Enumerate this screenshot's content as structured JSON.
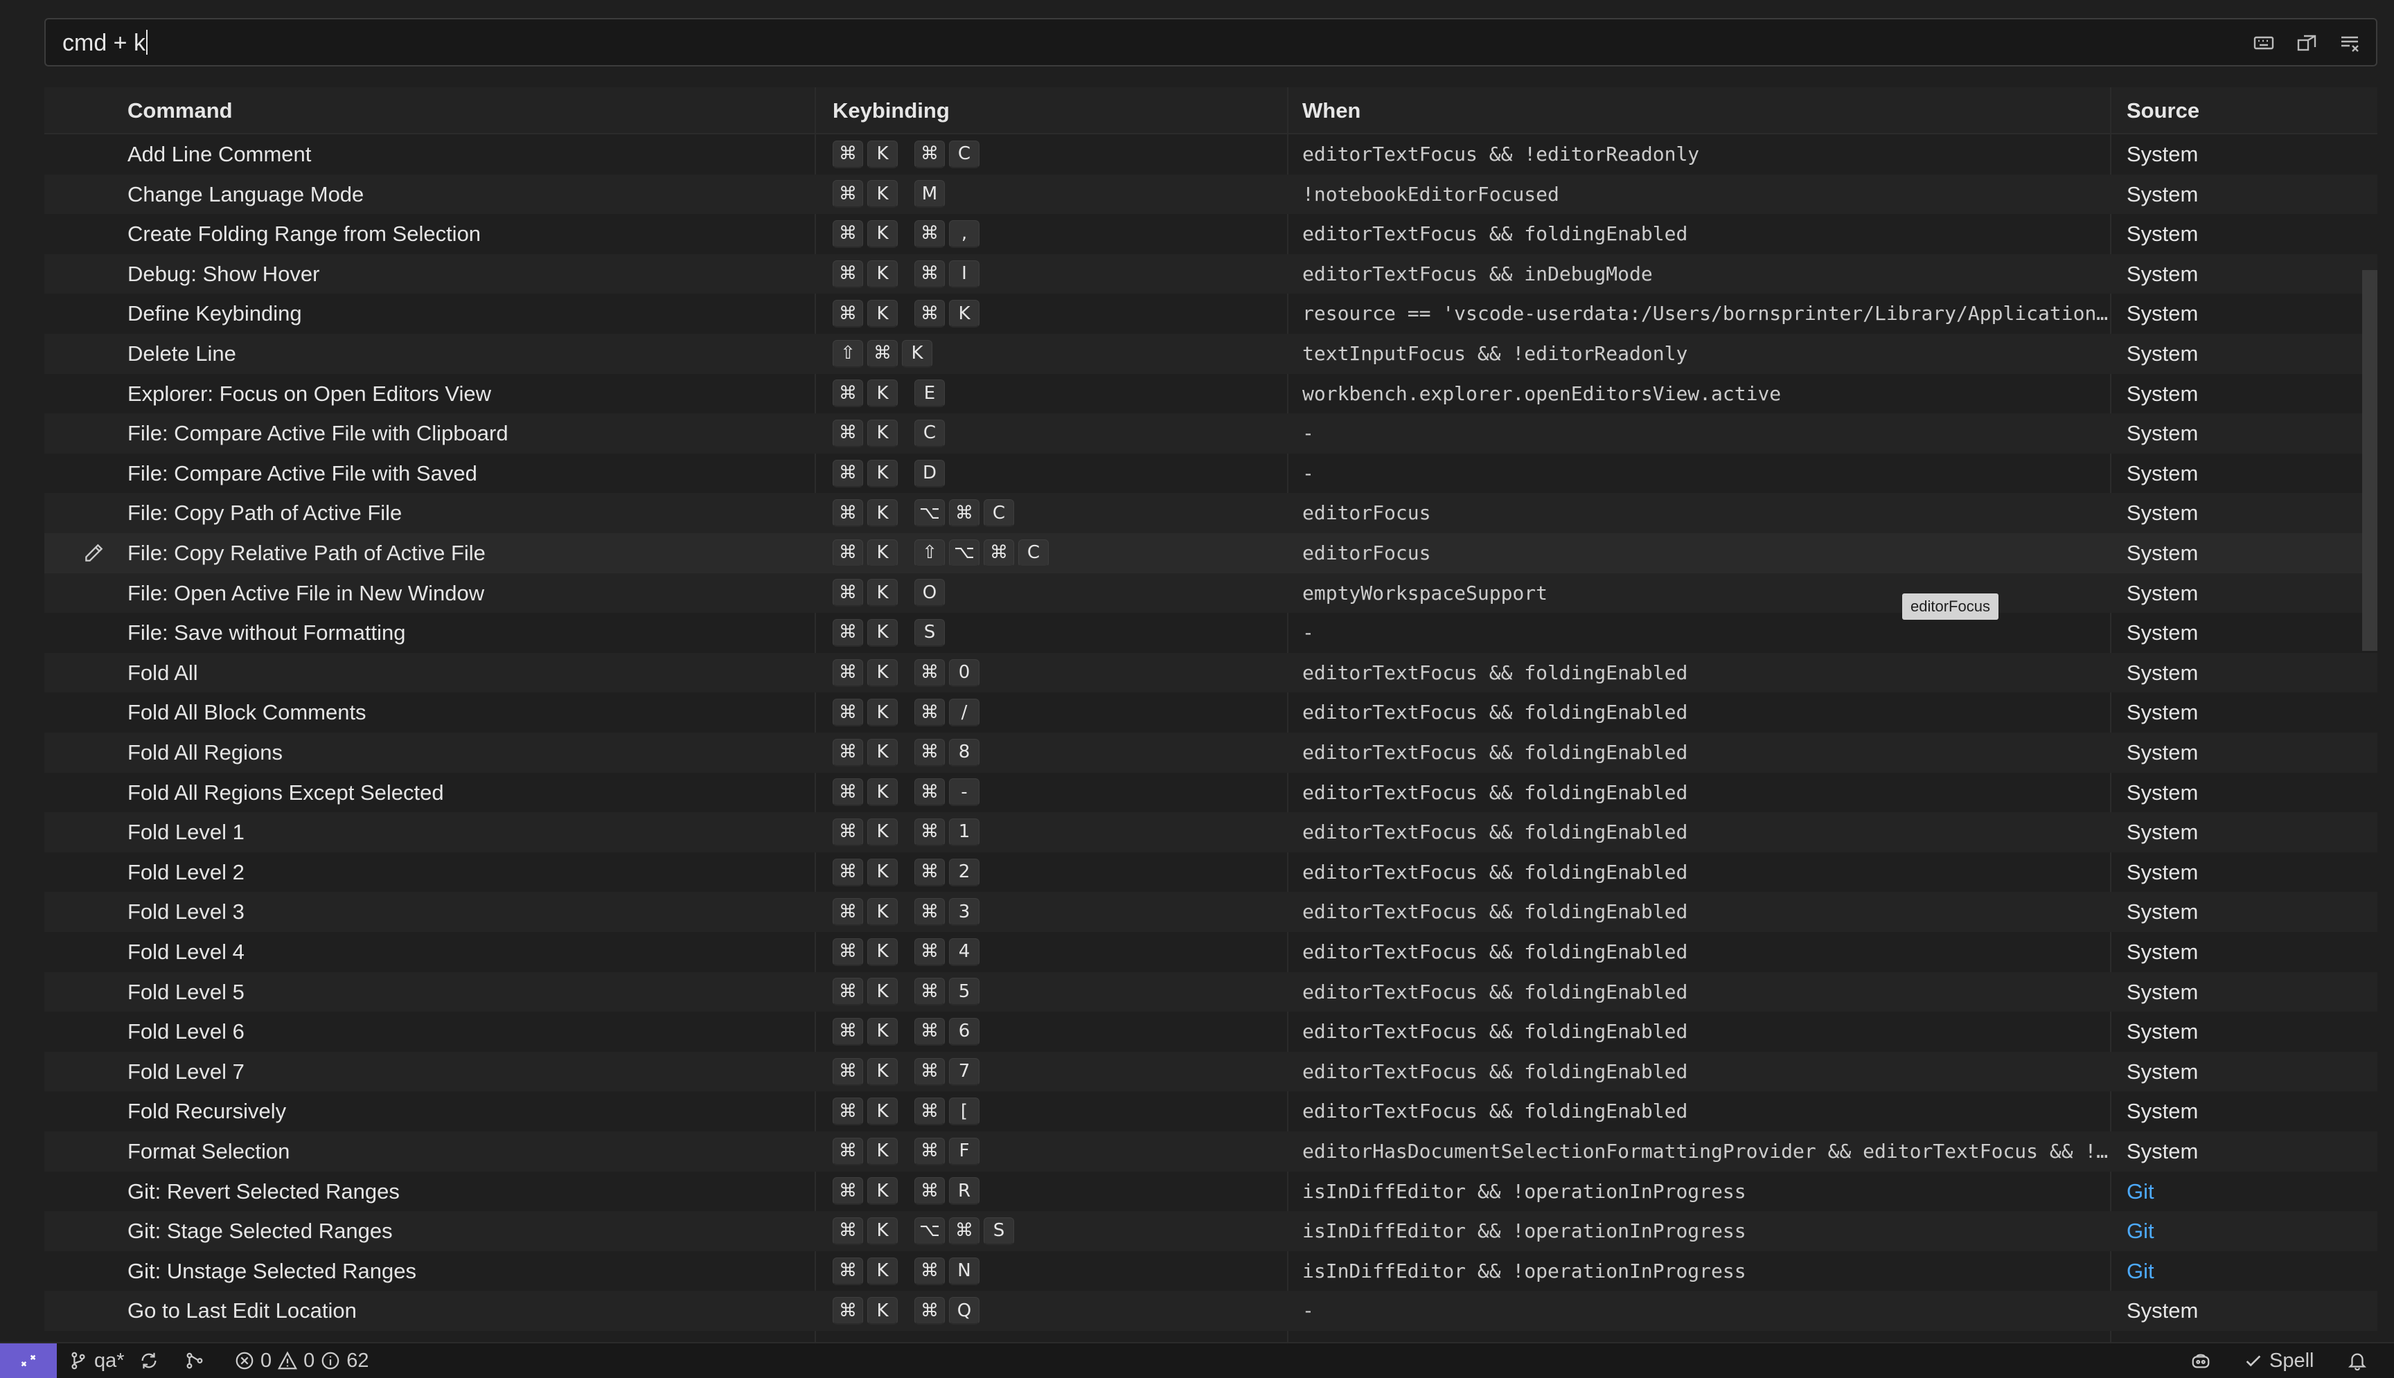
{
  "search": {
    "value": "cmd + k"
  },
  "table": {
    "headers": {
      "command": "Command",
      "keybinding": "Keybinding",
      "when": "When",
      "source": "Source"
    },
    "rows": [
      {
        "command": "Add Line Comment",
        "keys": [
          [
            "⌘",
            "K"
          ],
          [
            "⌘",
            "C"
          ]
        ],
        "when": "editorTextFocus && !editorReadonly",
        "source": "System"
      },
      {
        "command": "Change Language Mode",
        "keys": [
          [
            "⌘",
            "K"
          ],
          [
            "M"
          ]
        ],
        "when": "!notebookEditorFocused",
        "source": "System"
      },
      {
        "command": "Create Folding Range from Selection",
        "keys": [
          [
            "⌘",
            "K"
          ],
          [
            "⌘",
            ","
          ]
        ],
        "when": "editorTextFocus && foldingEnabled",
        "source": "System"
      },
      {
        "command": "Debug: Show Hover",
        "keys": [
          [
            "⌘",
            "K"
          ],
          [
            "⌘",
            "I"
          ]
        ],
        "when": "editorTextFocus && inDebugMode",
        "source": "System"
      },
      {
        "command": "Define Keybinding",
        "keys": [
          [
            "⌘",
            "K"
          ],
          [
            "⌘",
            "K"
          ]
        ],
        "when": "resource == 'vscode-userdata:/Users/bornsprinter/Library/Application…",
        "source": "System"
      },
      {
        "command": "Delete Line",
        "keys": [
          [
            "⇧",
            "⌘",
            "K"
          ]
        ],
        "when": "textInputFocus && !editorReadonly",
        "source": "System"
      },
      {
        "command": "Explorer: Focus on Open Editors View",
        "keys": [
          [
            "⌘",
            "K"
          ],
          [
            "E"
          ]
        ],
        "when": "workbench.explorer.openEditorsView.active",
        "source": "System"
      },
      {
        "command": "File: Compare Active File with Clipboard",
        "keys": [
          [
            "⌘",
            "K"
          ],
          [
            "C"
          ]
        ],
        "when": "-",
        "source": "System"
      },
      {
        "command": "File: Compare Active File with Saved",
        "keys": [
          [
            "⌘",
            "K"
          ],
          [
            "D"
          ]
        ],
        "when": "-",
        "source": "System"
      },
      {
        "command": "File: Copy Path of Active File",
        "keys": [
          [
            "⌘",
            "K"
          ],
          [
            "⌥",
            "⌘",
            "C"
          ]
        ],
        "when": "editorFocus",
        "source": "System"
      },
      {
        "command": "File: Copy Relative Path of Active File",
        "keys": [
          [
            "⌘",
            "K"
          ],
          [
            "⇧",
            "⌥",
            "⌘",
            "C"
          ]
        ],
        "when": "editorFocus",
        "source": "System"
      },
      {
        "command": "File: Open Active File in New Window",
        "keys": [
          [
            "⌘",
            "K"
          ],
          [
            "O"
          ]
        ],
        "when": "emptyWorkspaceSupport",
        "source": "System"
      },
      {
        "command": "File: Save without Formatting",
        "keys": [
          [
            "⌘",
            "K"
          ],
          [
            "S"
          ]
        ],
        "when": "-",
        "source": "System"
      },
      {
        "command": "Fold All",
        "keys": [
          [
            "⌘",
            "K"
          ],
          [
            "⌘",
            "0"
          ]
        ],
        "when": "editorTextFocus && foldingEnabled",
        "source": "System"
      },
      {
        "command": "Fold All Block Comments",
        "keys": [
          [
            "⌘",
            "K"
          ],
          [
            "⌘",
            "/"
          ]
        ],
        "when": "editorTextFocus && foldingEnabled",
        "source": "System"
      },
      {
        "command": "Fold All Regions",
        "keys": [
          [
            "⌘",
            "K"
          ],
          [
            "⌘",
            "8"
          ]
        ],
        "when": "editorTextFocus && foldingEnabled",
        "source": "System"
      },
      {
        "command": "Fold All Regions Except Selected",
        "keys": [
          [
            "⌘",
            "K"
          ],
          [
            "⌘",
            "-"
          ]
        ],
        "when": "editorTextFocus && foldingEnabled",
        "source": "System"
      },
      {
        "command": "Fold Level 1",
        "keys": [
          [
            "⌘",
            "K"
          ],
          [
            "⌘",
            "1"
          ]
        ],
        "when": "editorTextFocus && foldingEnabled",
        "source": "System"
      },
      {
        "command": "Fold Level 2",
        "keys": [
          [
            "⌘",
            "K"
          ],
          [
            "⌘",
            "2"
          ]
        ],
        "when": "editorTextFocus && foldingEnabled",
        "source": "System"
      },
      {
        "command": "Fold Level 3",
        "keys": [
          [
            "⌘",
            "K"
          ],
          [
            "⌘",
            "3"
          ]
        ],
        "when": "editorTextFocus && foldingEnabled",
        "source": "System"
      },
      {
        "command": "Fold Level 4",
        "keys": [
          [
            "⌘",
            "K"
          ],
          [
            "⌘",
            "4"
          ]
        ],
        "when": "editorTextFocus && foldingEnabled",
        "source": "System"
      },
      {
        "command": "Fold Level 5",
        "keys": [
          [
            "⌘",
            "K"
          ],
          [
            "⌘",
            "5"
          ]
        ],
        "when": "editorTextFocus && foldingEnabled",
        "source": "System"
      },
      {
        "command": "Fold Level 6",
        "keys": [
          [
            "⌘",
            "K"
          ],
          [
            "⌘",
            "6"
          ]
        ],
        "when": "editorTextFocus && foldingEnabled",
        "source": "System"
      },
      {
        "command": "Fold Level 7",
        "keys": [
          [
            "⌘",
            "K"
          ],
          [
            "⌘",
            "7"
          ]
        ],
        "when": "editorTextFocus && foldingEnabled",
        "source": "System"
      },
      {
        "command": "Fold Recursively",
        "keys": [
          [
            "⌘",
            "K"
          ],
          [
            "⌘",
            "["
          ]
        ],
        "when": "editorTextFocus && foldingEnabled",
        "source": "System"
      },
      {
        "command": "Format Selection",
        "keys": [
          [
            "⌘",
            "K"
          ],
          [
            "⌘",
            "F"
          ]
        ],
        "when": "editorHasDocumentSelectionFormattingProvider && editorTextFocus && !…",
        "source": "System"
      },
      {
        "command": "Git: Revert Selected Ranges",
        "keys": [
          [
            "⌘",
            "K"
          ],
          [
            "⌘",
            "R"
          ]
        ],
        "when": "isInDiffEditor && !operationInProgress",
        "source": "Git"
      },
      {
        "command": "Git: Stage Selected Ranges",
        "keys": [
          [
            "⌘",
            "K"
          ],
          [
            "⌥",
            "⌘",
            "S"
          ]
        ],
        "when": "isInDiffEditor && !operationInProgress",
        "source": "Git"
      },
      {
        "command": "Git: Unstage Selected Ranges",
        "keys": [
          [
            "⌘",
            "K"
          ],
          [
            "⌘",
            "N"
          ]
        ],
        "when": "isInDiffEditor && !operationInProgress",
        "source": "Git"
      },
      {
        "command": "Go to Last Edit Location",
        "keys": [
          [
            "⌘",
            "K"
          ],
          [
            "⌘",
            "Q"
          ]
        ],
        "when": "-",
        "source": "System"
      }
    ]
  },
  "tooltip": "editorFocus",
  "statusbar": {
    "branch": "qa*",
    "errors": "0",
    "warnings": "0",
    "info": "62",
    "spell": "Spell"
  },
  "colors": {
    "accent": "#6b5ccf",
    "git_source": "#4daafc"
  }
}
